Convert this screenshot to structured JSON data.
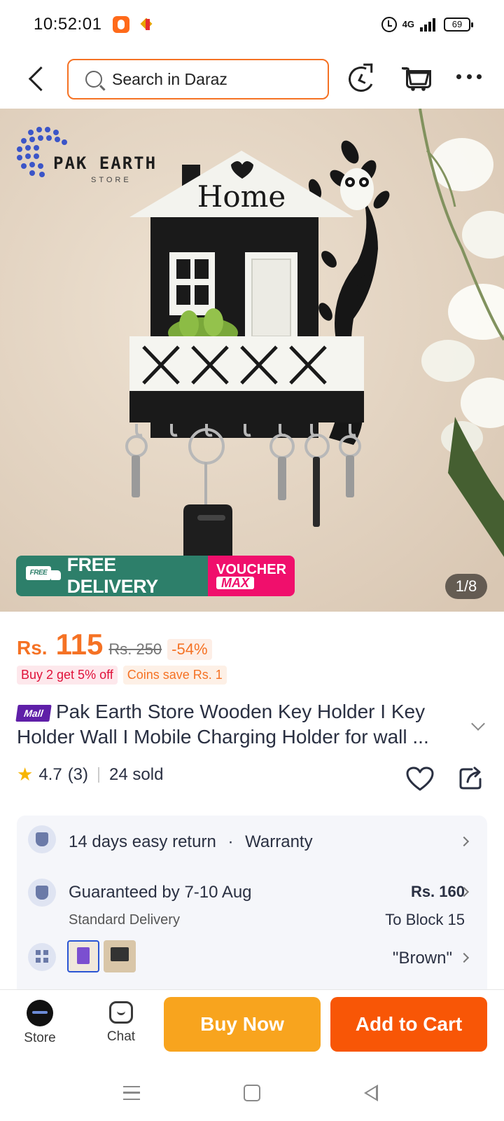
{
  "status_bar": {
    "time": "10:52:01",
    "network": "4G",
    "battery": "69"
  },
  "header": {
    "search_placeholder": "Search in Daraz"
  },
  "gallery": {
    "brand_name": "PAK EARTH",
    "brand_sub": "STORE",
    "sign_text": "Home",
    "promo_free_label": "FREE DELIVERY",
    "promo_voucher_line1": "VOUCHER",
    "promo_voucher_line2": "MAX",
    "counter": "1/8"
  },
  "price": {
    "currency": "Rs.",
    "current": "115",
    "original": "Rs. 250",
    "discount": "-54%"
  },
  "promotions": [
    "Buy 2 get 5% off",
    "Coins save Rs. 1"
  ],
  "product": {
    "badge": "Mall",
    "title": "Pak Earth Store Wooden Key Holder I Key Holder Wall I Mobile Charging Holder for wall ...",
    "rating": "4.7",
    "review_count": "(3)",
    "sold": "24 sold"
  },
  "services": {
    "return_label": "14 days easy return",
    "separator": "·",
    "warranty_label": "Warranty",
    "delivery_main": "Guaranteed by 7-10 Aug",
    "delivery_sub": "Standard Delivery",
    "delivery_fee": "Rs. 160",
    "delivery_location": "To Block 15",
    "variant_selected": "\"Brown\""
  },
  "bottom_bar": {
    "store_label": "Store",
    "chat_label": "Chat",
    "buy_now_label": "Buy Now",
    "add_to_cart_label": "Add to Cart"
  },
  "colors": {
    "accent": "#f57224",
    "buy_now": "#f8a41e",
    "add_to_cart": "#f85606",
    "free_delivery": "#2d7f6a",
    "voucher": "#f00f6c",
    "mall_badge": "#5f1fa8",
    "star": "#f7b500"
  }
}
